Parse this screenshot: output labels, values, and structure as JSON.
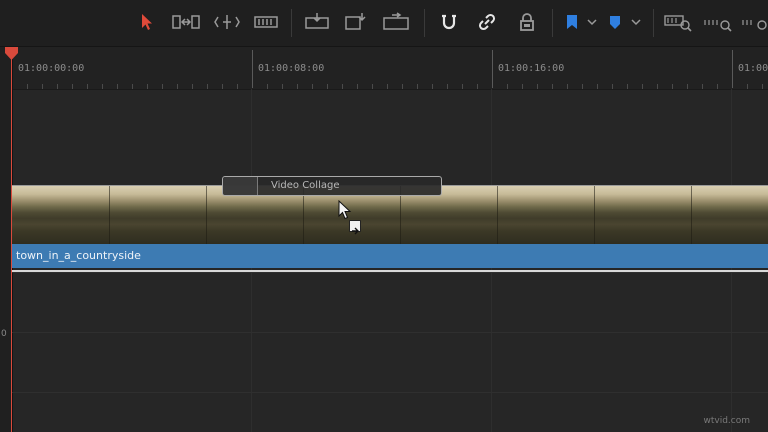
{
  "toolbar": {
    "tools": [
      {
        "name": "selection-mode-icon"
      },
      {
        "name": "trim-edit-mode-icon"
      },
      {
        "name": "dynamic-trim-icon"
      },
      {
        "name": "blade-edit-icon"
      },
      {
        "name": "insert-clip-icon"
      },
      {
        "name": "overwrite-clip-icon"
      },
      {
        "name": "replace-clip-icon"
      },
      {
        "name": "snapping-icon"
      },
      {
        "name": "linked-selection-icon"
      },
      {
        "name": "position-lock-icon"
      },
      {
        "name": "flag-icon"
      },
      {
        "name": "marker-icon"
      },
      {
        "name": "zoom-full-icon"
      },
      {
        "name": "zoom-detail-icon"
      }
    ],
    "accent_select": "#e04a3a",
    "accent_flag": "#2f7fe0"
  },
  "ruler": {
    "timecodes": [
      "01:00:00:00",
      "01:00:08:00",
      "01:00:16:00",
      "01:00:"
    ]
  },
  "clip": {
    "name": "town_in_a_countryside",
    "color": "#3d7bb3"
  },
  "drag_title": {
    "label": "Video Collage"
  },
  "gutter": {
    "track_number": "0"
  },
  "watermark": "wtvid.com",
  "playhead_color": "#d94a3c"
}
